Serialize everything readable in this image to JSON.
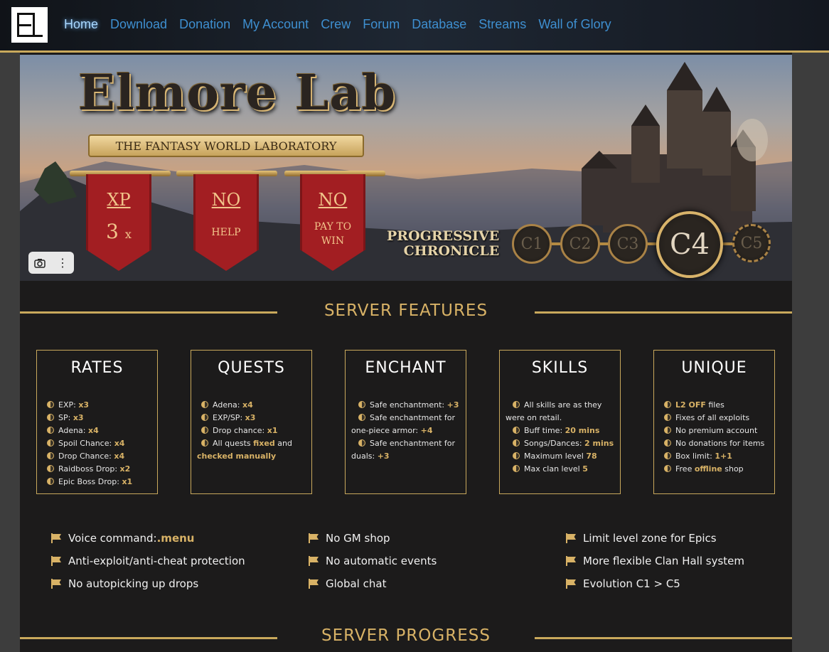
{
  "nav": {
    "logo_text": "EL",
    "links": [
      "Home",
      "Download",
      "Donation",
      "My Account",
      "Crew",
      "Forum",
      "Database",
      "Streams",
      "Wall of Glory"
    ],
    "active": "Home"
  },
  "hero": {
    "title": "Elmore Lab",
    "subtitle": "THE FANTASY WORLD LABORATORY",
    "banners": [
      {
        "top": "XP",
        "bottom": "3",
        "suffix": "x"
      },
      {
        "top": "NO",
        "bottom": "HELP"
      },
      {
        "top": "NO",
        "bottom": "PAY TO WIN"
      }
    ],
    "progressive_line1": "PROGRESSIVE",
    "progressive_line2": "CHRONICLE",
    "chronicles": [
      "C1",
      "C2",
      "C3",
      "C4",
      "C5"
    ],
    "current_chronicle": "C4"
  },
  "features": {
    "title": "SERVER FEATURES",
    "cards": [
      {
        "title": "RATES",
        "lines": [
          {
            "label": "EXP: ",
            "value": "x3"
          },
          {
            "label": "SP: ",
            "value": "x3"
          },
          {
            "label": "Adena: ",
            "value": "x4"
          },
          {
            "label": "Spoil Chance: ",
            "value": "x4"
          },
          {
            "label": "Drop Chance: ",
            "value": "x4"
          },
          {
            "label": "Raidboss Drop: ",
            "value": "x2"
          },
          {
            "label": "Epic Boss Drop: ",
            "value": "x1"
          }
        ]
      },
      {
        "title": "QUESTS",
        "lines": [
          {
            "label": "Adena: ",
            "value": "x4"
          },
          {
            "label": "EXP/SP: ",
            "value": "x3"
          },
          {
            "label": "Drop chance: ",
            "value": "x1"
          },
          {
            "label": "All quests ",
            "value": "fixed",
            "rest": " and",
            "cont": "checked manually"
          }
        ]
      },
      {
        "title": "ENCHANT",
        "lines": [
          {
            "label": "Safe enchantment: ",
            "value": "+3"
          },
          {
            "label": "Safe enchantment for",
            "cont_label": "one-piece armor: ",
            "value": "+4"
          },
          {
            "label": "Safe enchantment for",
            "cont_label": "duals: ",
            "value": "+3"
          }
        ]
      },
      {
        "title": "SKILLS",
        "lines": [
          {
            "label": "All skills are as they",
            "cont_label": "were on retail."
          },
          {
            "label": "Buff time: ",
            "value": "20 mins"
          },
          {
            "label": "Songs/Dances: ",
            "value": "2 mins"
          },
          {
            "label": "Maximum level ",
            "value": "78"
          },
          {
            "label": "Max clan level ",
            "value": "5"
          }
        ]
      },
      {
        "title": "UNIQUE",
        "lines": [
          {
            "value_first": "L2 OFF",
            "label": " files"
          },
          {
            "label": "Fixes of all exploits"
          },
          {
            "label": "No premium account"
          },
          {
            "label": "No donations for items"
          },
          {
            "label": "Box limit: ",
            "value": "1+1"
          },
          {
            "label": "Free ",
            "value": "offline",
            "rest": " shop"
          }
        ]
      }
    ]
  },
  "extras": {
    "col1": [
      {
        "text": "Voice command: ",
        "hi": ".menu"
      },
      {
        "text": "Anti-exploit/anti-cheat protection"
      },
      {
        "text": "No autopicking up drops"
      }
    ],
    "col2": [
      {
        "text": "No GM shop"
      },
      {
        "text": "No automatic events"
      },
      {
        "text": "Global chat"
      }
    ],
    "col3": [
      {
        "text": "Limit level zone for Epics"
      },
      {
        "text": "More flexible Clan Hall system"
      },
      {
        "text": "Evolution C1 > C5"
      }
    ]
  },
  "progress": {
    "title": "SERVER PROGRESS"
  },
  "toolbar": {
    "camera_icon": "camera-icon",
    "more_icon": "more-vertical-icon"
  },
  "colors": {
    "accent_gold": "#c9a95c",
    "nav_link": "#3e8fd0",
    "banner_red": "#a21e22",
    "background": "#1c1b1b"
  }
}
